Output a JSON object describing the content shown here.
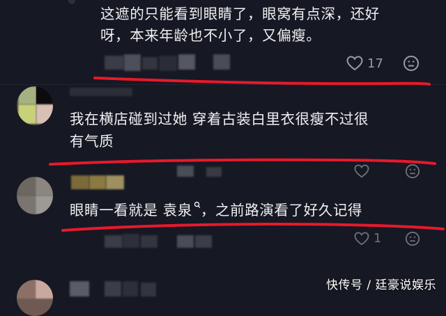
{
  "comments": [
    {
      "text_line1": "这遮的只能看到眼睛了，眼窝有点深，还好",
      "text_line2": "呀，本来年龄也不小了，又偏瘦。",
      "like_count": "17"
    },
    {
      "text_line1": "我在横店碰到过她 穿着古装白里衣很瘦不过很",
      "text_line2": "有气质"
    },
    {
      "text_before_link": "眼睛一看就是 ",
      "link_text": "袁泉",
      "text_after_link": "，之前路演看了好久记得",
      "like_count": "1"
    }
  ],
  "watermark": "快传号 / 廷豪说娱乐",
  "colors": {
    "background": "#161823",
    "underline": "#e8192c",
    "meta_grey": "#9a9ba3"
  },
  "icons": [
    "heart-icon",
    "dislike-face-icon",
    "search-link-icon"
  ]
}
